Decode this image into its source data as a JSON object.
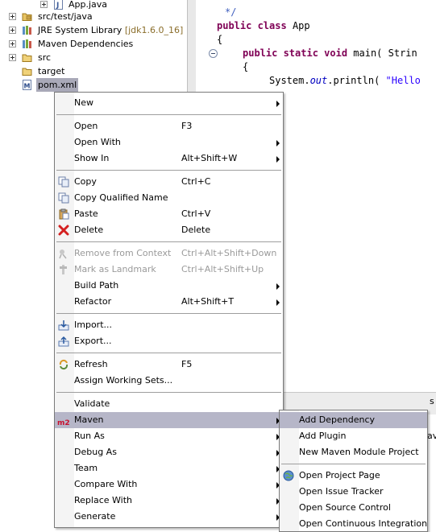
{
  "tree": {
    "items": [
      {
        "label": "App.java",
        "decoration": ""
      },
      {
        "label": "src/test/java",
        "decoration": ""
      },
      {
        "label": "JRE System Library",
        "decoration": "[jdk1.6.0_16]"
      },
      {
        "label": "Maven Dependencies",
        "decoration": ""
      },
      {
        "label": "src",
        "decoration": ""
      },
      {
        "label": "target",
        "decoration": ""
      },
      {
        "label": "pom.xml",
        "decoration": ""
      }
    ]
  },
  "editor": {
    "lines": {
      "comment_end": "*/",
      "class_kw": "public class",
      "class_name": "App",
      "brace_open": "{",
      "method_kw": "public static void",
      "method_rest": "main( Strin",
      "brace2": "{",
      "println_pre": "System.",
      "println_out": "out",
      "println_mid": ".println( ",
      "println_str": "\"Hello"
    },
    "bottom_tab_fragment": "s",
    "bottom_text_fragment": "av"
  },
  "context_menu": {
    "items": [
      {
        "label": "New",
        "accel": "",
        "submenu": true
      },
      {
        "label": "Open",
        "accel": "F3",
        "submenu": false
      },
      {
        "label": "Open With",
        "accel": "",
        "submenu": true
      },
      {
        "label": "Show In",
        "accel": "Alt+Shift+W",
        "submenu": true
      },
      {
        "label": "Copy",
        "accel": "Ctrl+C",
        "submenu": false
      },
      {
        "label": "Copy Qualified Name",
        "accel": "",
        "submenu": false
      },
      {
        "label": "Paste",
        "accel": "Ctrl+V",
        "submenu": false
      },
      {
        "label": "Delete",
        "accel": "Delete",
        "submenu": false
      },
      {
        "label": "Remove from Context",
        "accel": "Ctrl+Alt+Shift+Down",
        "submenu": false,
        "disabled": true
      },
      {
        "label": "Mark as Landmark",
        "accel": "Ctrl+Alt+Shift+Up",
        "submenu": false,
        "disabled": true
      },
      {
        "label": "Build Path",
        "accel": "",
        "submenu": true
      },
      {
        "label": "Refactor",
        "accel": "Alt+Shift+T",
        "submenu": true
      },
      {
        "label": "Import...",
        "accel": "",
        "submenu": false
      },
      {
        "label": "Export...",
        "accel": "",
        "submenu": false
      },
      {
        "label": "Refresh",
        "accel": "F5",
        "submenu": false
      },
      {
        "label": "Assign Working Sets...",
        "accel": "",
        "submenu": false
      },
      {
        "label": "Validate",
        "accel": "",
        "submenu": false
      },
      {
        "label": "Maven",
        "accel": "",
        "submenu": true,
        "highlighted": true,
        "badge": "m2"
      },
      {
        "label": "Run As",
        "accel": "",
        "submenu": true
      },
      {
        "label": "Debug As",
        "accel": "",
        "submenu": true
      },
      {
        "label": "Team",
        "accel": "",
        "submenu": true
      },
      {
        "label": "Compare With",
        "accel": "",
        "submenu": true
      },
      {
        "label": "Replace With",
        "accel": "",
        "submenu": true
      },
      {
        "label": "Generate",
        "accel": "",
        "submenu": true
      }
    ]
  },
  "maven_submenu": {
    "items": [
      {
        "label": "Add Dependency",
        "highlighted": true
      },
      {
        "label": "Add Plugin"
      },
      {
        "label": "New Maven Module Project"
      },
      {
        "label": "Open Project Page"
      },
      {
        "label": "Open Issue Tracker"
      },
      {
        "label": "Open Source Control"
      },
      {
        "label": "Open Continuous Integration"
      }
    ]
  },
  "colors": {
    "keyword": "#7f0055",
    "string": "#2a00ff",
    "comment": "#3f5fbf",
    "menu_highlight": "#b6b6c8",
    "m2_badge": "#c8102e"
  }
}
